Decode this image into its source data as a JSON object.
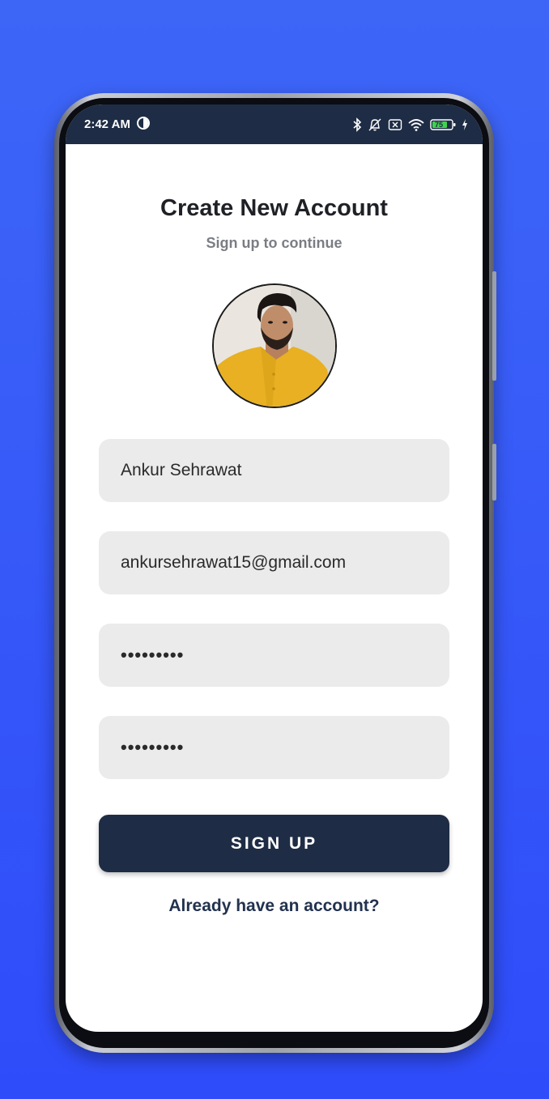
{
  "status_bar": {
    "time": "2:42 AM",
    "battery_level": "75",
    "icons": [
      "bluetooth-icon",
      "muted-bell-icon",
      "sim-icon",
      "wifi-icon",
      "battery-icon",
      "charging-icon"
    ]
  },
  "header": {
    "title": "Create New Account",
    "subtitle": "Sign up to continue"
  },
  "form": {
    "name_value": "Ankur Sehrawat",
    "email_value": "ankursehrawat15@gmail.com",
    "password_value": "•••••••••",
    "confirm_password_value": "•••••••••",
    "submit_label": "SIGN UP",
    "login_link": "Already have an account?"
  },
  "colors": {
    "background": "#3d66f7",
    "primary": "#1e2d45",
    "field_bg": "#ebebeb",
    "link": "#22324e"
  }
}
